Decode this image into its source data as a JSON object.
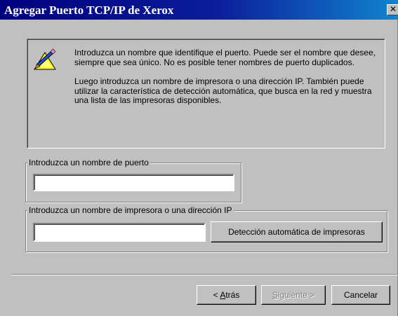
{
  "window": {
    "title": "Agregar Puerto TCP/IP de Xerox",
    "close_glyph": "✕"
  },
  "info": {
    "icon": "wizard-pencil-icon",
    "paragraph1": "Introduzca un nombre que identifique el puerto.  Puede ser el nombre que desee, siempre que sea único. No es posible tener nombres de puerto duplicados.",
    "paragraph2": "Luego introduzca un nombre de impresora o una dirección IP. También puede utilizar la característica de detección automática, que busca en la red y muestra una lista de las impresoras disponibles."
  },
  "port_group": {
    "legend": "Introduzca un  nombre de puerto",
    "value": ""
  },
  "printer_group": {
    "legend": "Introduzca un  nombre de impresora o una dirección IP",
    "value": "",
    "detect_label": "Detección automática  de impresoras"
  },
  "buttons": {
    "back_prefix": "< ",
    "back_mnemonic": "A",
    "back_rest": "trás",
    "next_mnemonic": "S",
    "next_rest": "iguiente >",
    "cancel_label": "Cancelar"
  },
  "colors": {
    "title_start": "#000080",
    "title_end": "#1084d0",
    "face": "#c0c0c0"
  }
}
